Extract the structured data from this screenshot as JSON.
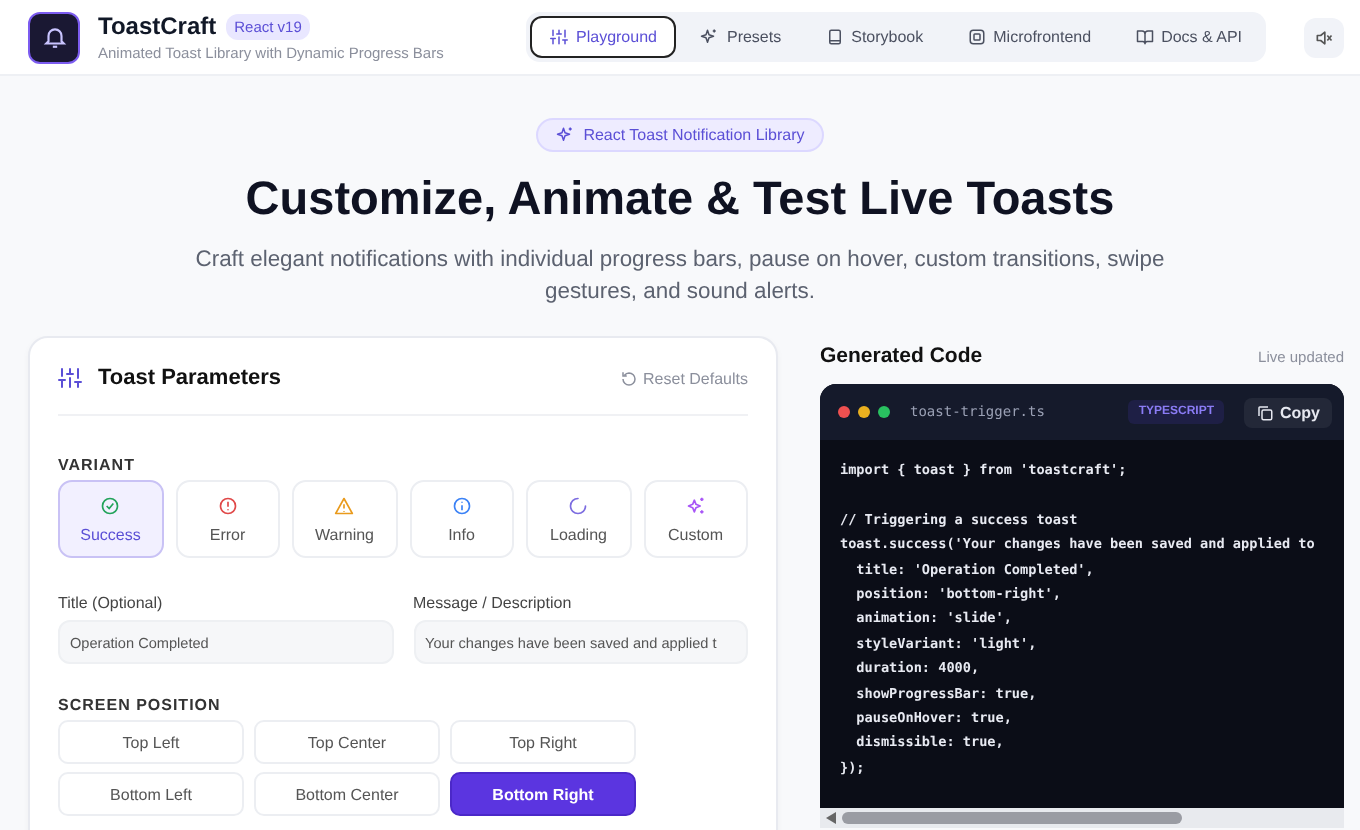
{
  "header": {
    "logo_title": "ToastCraft",
    "version_badge": "React v19",
    "subtitle": "Animated Toast Library with Dynamic Progress Bars",
    "nav": [
      {
        "label": "Playground",
        "kind": "sliders",
        "selected": true
      },
      {
        "label": "Presets",
        "kind": "sparkle",
        "selected": false
      },
      {
        "label": "Storybook",
        "kind": "book",
        "selected": false
      },
      {
        "label": "Microfrontend",
        "kind": "box",
        "selected": false
      },
      {
        "label": "Docs & API",
        "kind": "openbook",
        "selected": false
      }
    ],
    "sound_muted": true
  },
  "hero": {
    "badge": "React Toast Notification Library",
    "title": "Customize, Animate & Test Live Toasts",
    "subtitle": "Craft elegant notifications with individual progress bars, pause on hover, custom transitions, swipe gestures, and sound alerts."
  },
  "parameters": {
    "title": "Toast Parameters",
    "reset": "Reset Defaults",
    "variant_label": "VARIANT",
    "variants": [
      {
        "label": "Success",
        "kind": "success",
        "selected": true
      },
      {
        "label": "Error",
        "kind": "error",
        "selected": false
      },
      {
        "label": "Warning",
        "kind": "warning",
        "selected": false
      },
      {
        "label": "Info",
        "kind": "info",
        "selected": false
      },
      {
        "label": "Loading",
        "kind": "loading",
        "selected": false
      },
      {
        "label": "Custom",
        "kind": "custom",
        "selected": false
      }
    ],
    "fields": [
      {
        "label": "Title (Optional)",
        "value": "Operation Completed"
      },
      {
        "label": "Message / Description",
        "value": "Your changes have been saved and applied t"
      }
    ],
    "position_label": "SCREEN POSITION",
    "positions": [
      {
        "label": "Top Left",
        "selected": false
      },
      {
        "label": "Top Center",
        "selected": false
      },
      {
        "label": "Top Right",
        "selected": false
      },
      {
        "label": "Bottom Left",
        "selected": false
      },
      {
        "label": "Bottom Center",
        "selected": false
      },
      {
        "label": "Bottom Right",
        "selected": true
      }
    ]
  },
  "code": {
    "title": "Generated Code",
    "status": "Live updated",
    "filename": "toast-trigger.ts",
    "language": "TYPESCRIPT",
    "copy": "Copy",
    "blocks": [
      [
        "import { toast } from 'toastcraft';"
      ],
      [
        "// Triggering a success toast",
        "toast.success('Your changes have been saved and applied to",
        "  title: 'Operation Completed',",
        "  position: 'bottom-right',",
        "  animation: 'slide',",
        "  styleVariant: 'light',",
        "  duration: 4000,",
        "  showProgressBar: true,",
        "  pauseOnHover: true,",
        "  dismissible: true,",
        "});"
      ]
    ]
  }
}
